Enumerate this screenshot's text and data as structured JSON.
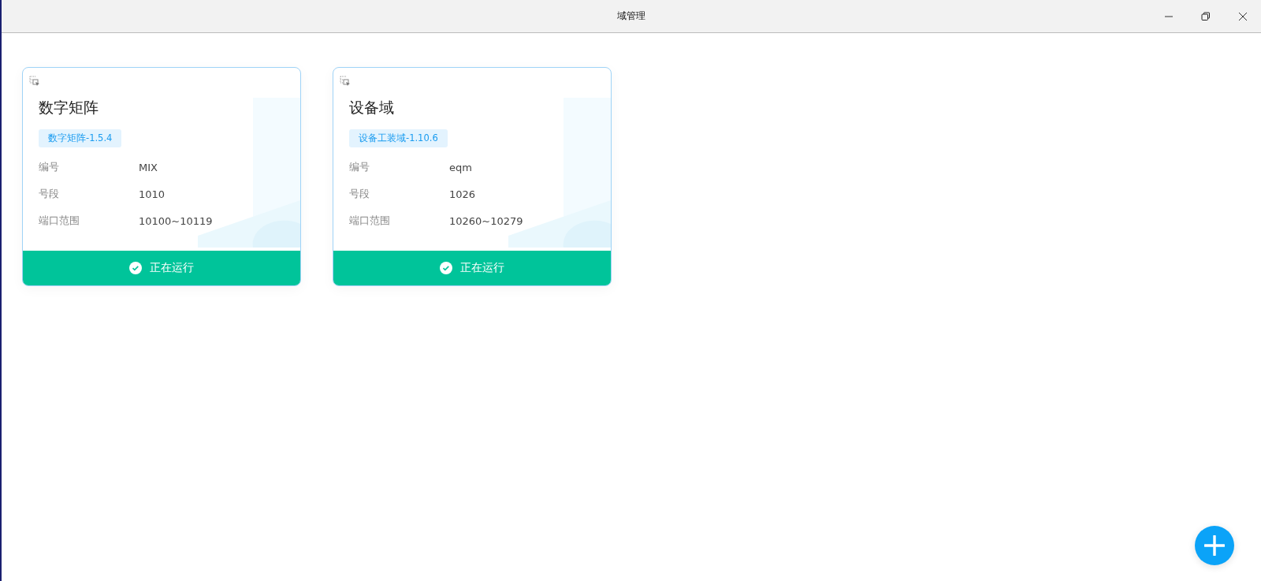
{
  "window": {
    "title": "域管理"
  },
  "domains": [
    {
      "name": "数字矩阵",
      "version": "数字矩阵-1.5.4",
      "fields": [
        {
          "label": "编号",
          "value": "MIX"
        },
        {
          "label": "号段",
          "value": "1010"
        },
        {
          "label": "端口范围",
          "value": "10100~10119"
        }
      ],
      "status": {
        "kind": "running",
        "label": "正在运行"
      }
    },
    {
      "name": "设备域",
      "version": "设备工装域-1.10.6",
      "fields": [
        {
          "label": "编号",
          "value": "eqm"
        },
        {
          "label": "号段",
          "value": "1026"
        },
        {
          "label": "端口范围",
          "value": "10260~10279"
        }
      ],
      "status": {
        "kind": "running",
        "label": "正在运行"
      }
    }
  ]
}
